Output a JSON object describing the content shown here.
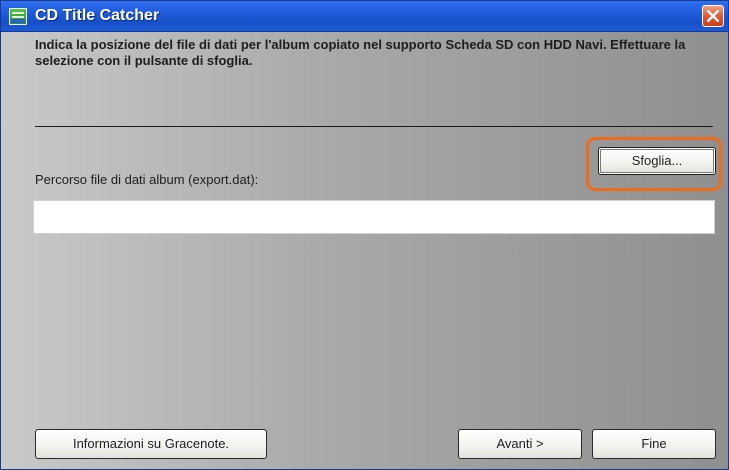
{
  "window": {
    "title": "CD Title Catcher",
    "app_icon": "navi-disc-app-icon",
    "close_icon": "close-x-icon"
  },
  "main": {
    "instruction": "Indica la posizione del file di dati per l'album copiato nel supporto Scheda SD con HDD Navi. Effettuare la selezione con il pulsante di sfoglia.",
    "path_label": "Percorso file di dati album (export.dat):",
    "path_value": "",
    "path_placeholder": "",
    "browse_label": "Sfoglia..."
  },
  "footer": {
    "info_label": "Informazioni su Gracenote.",
    "next_label": "Avanti >",
    "finish_label": "Fine"
  },
  "colors": {
    "titlebar": "#1f5bdc",
    "highlight": "#ee6b1c",
    "close_button": "#e0532e"
  }
}
